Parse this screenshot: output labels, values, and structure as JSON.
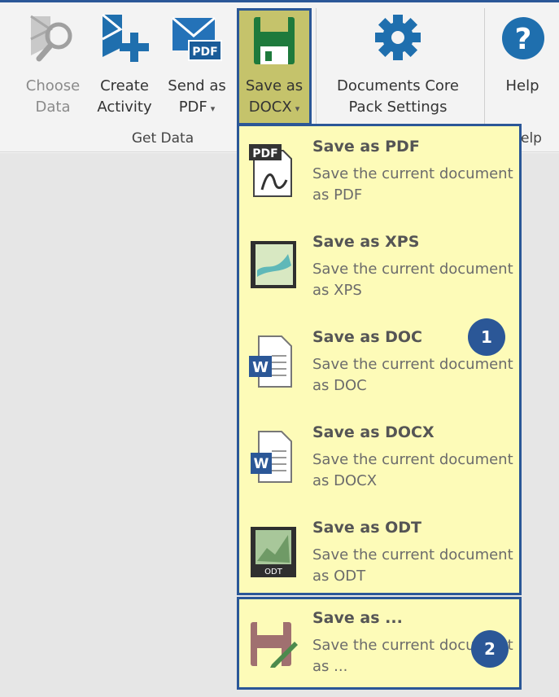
{
  "ribbon": {
    "choose_data": {
      "line1": "Choose",
      "line2": "Data"
    },
    "create_activity": {
      "line1": "Create",
      "line2": "Activity"
    },
    "send_as_pdf": {
      "line1": "Send as",
      "line2": "PDF",
      "arrow": "▾"
    },
    "save_as_docx": {
      "line1": "Save as",
      "line2": "DOCX",
      "arrow": "▾"
    },
    "dcp_settings": {
      "line1": "Documents Core",
      "line2": "Pack Settings"
    },
    "help": {
      "line1": "Help"
    },
    "group_get_data": "Get Data",
    "group_help_partial": "elp"
  },
  "menu": {
    "items": [
      {
        "title": "Save as PDF",
        "desc": "Save the current document as PDF"
      },
      {
        "title": "Save as XPS",
        "desc": "Save the current document as XPS"
      },
      {
        "title": "Save as DOC",
        "desc": "Save the current document as DOC"
      },
      {
        "title": "Save as DOCX",
        "desc": "Save the current document as DOCX"
      },
      {
        "title": "Save as ODT",
        "desc": "Save the current document as ODT"
      }
    ],
    "save_as": {
      "title": "Save as ...",
      "desc": "Save the current document as ..."
    }
  },
  "callouts": {
    "one": "1",
    "two": "2"
  },
  "colors": {
    "accent": "#2b5797",
    "menu_bg": "#fdfbb8",
    "highlight": "#c5c36b"
  }
}
